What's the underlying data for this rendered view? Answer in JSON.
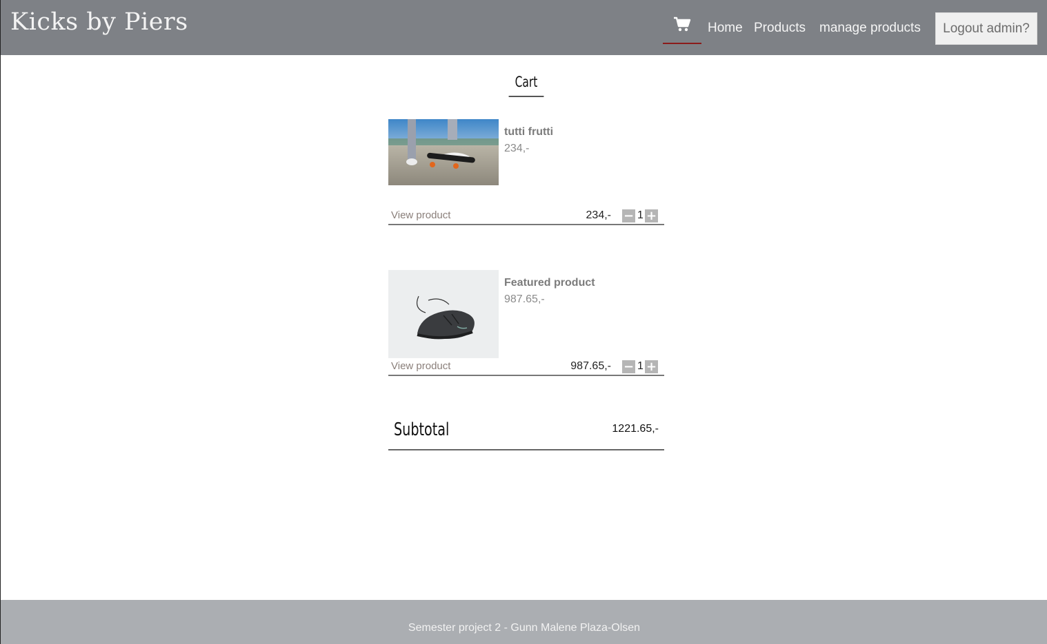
{
  "header": {
    "brand": "Kicks by Piers",
    "nav": {
      "cart_icon": "shopping-cart-icon",
      "home": "Home",
      "products": "Products",
      "manage": "manage products"
    },
    "logout_label": "Logout admin?",
    "bg_color": "#7e8186",
    "active_underline_color": "#8b1a1a"
  },
  "cart": {
    "title": "Cart",
    "items": [
      {
        "name": "tutti frutti",
        "price": "234,-",
        "view_label": "View product",
        "line_price": "234,-",
        "quantity": "1"
      },
      {
        "name": "Featured product",
        "price": "987.65,-",
        "view_label": "View product",
        "line_price": "987.65,-",
        "quantity": "1"
      }
    ],
    "subtotal_label": "Subtotal",
    "subtotal_value": "1221.65,-"
  },
  "footer": {
    "text": "Semester project 2 - Gunn Malene Plaza-Olsen",
    "bg_color": "#abaeb2"
  }
}
